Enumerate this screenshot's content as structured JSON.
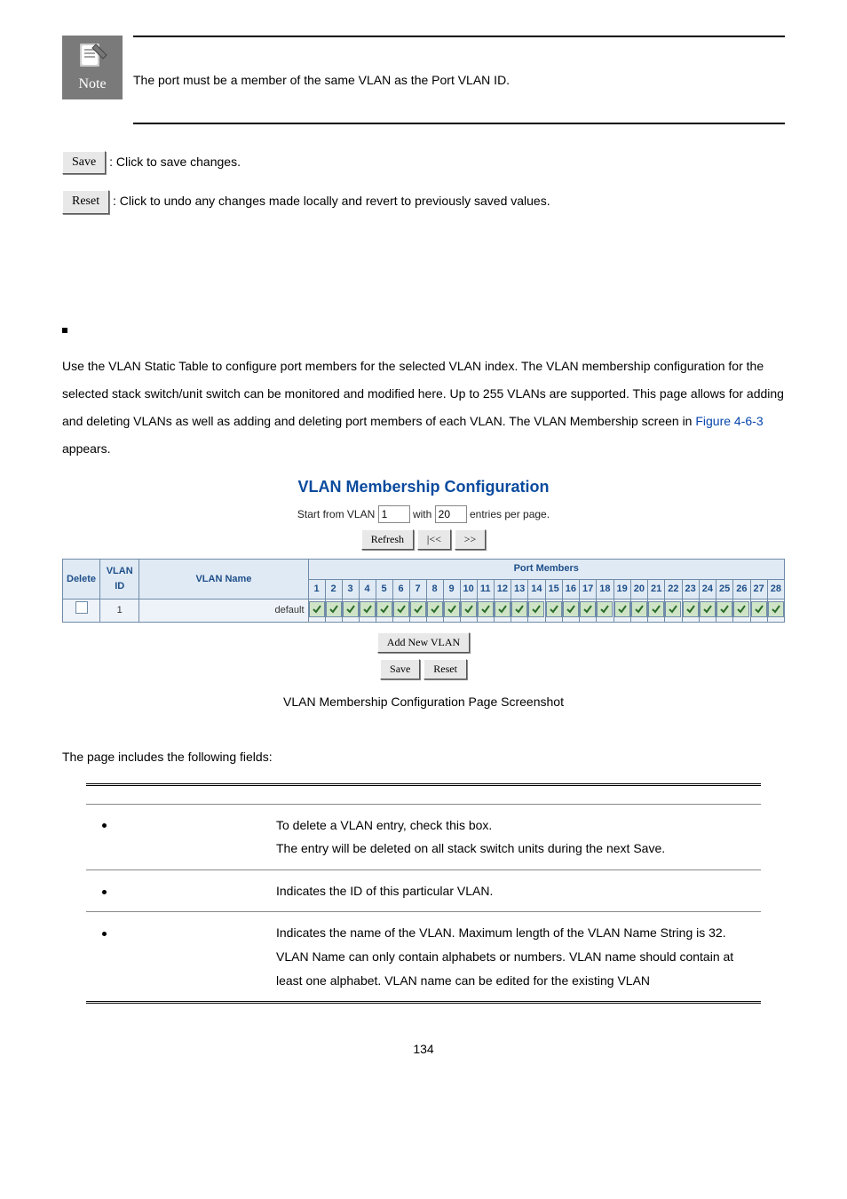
{
  "note": {
    "label": "Note",
    "text": "The port must be a member of the same VLAN as the Port VLAN ID."
  },
  "buttons": {
    "save": "Save",
    "reset": "Reset",
    "refresh": "Refresh",
    "prev": "|<<",
    "next": ">>",
    "add_new": "Add New VLAN"
  },
  "button_desc": {
    "save": ": Click to save changes.",
    "reset": ": Click to undo any changes made locally and revert to previously saved values."
  },
  "body1": "Use the VLAN Static Table to configure port members for the selected VLAN index. The VLAN membership configuration for the selected stack switch/unit switch can be monitored and modified here. Up to 255 VLANs are supported. This page allows for adding and deleting VLANs as well as adding and deleting port members of each VLAN. The VLAN Membership screen in ",
  "figure_ref": "Figure 4-6-3",
  "body1_after": " appears.",
  "vlan": {
    "title": "VLAN Membership Configuration",
    "start_label": "Start from VLAN ",
    "start_value": "1",
    "with_label": " with ",
    "per_page_value": "20",
    "entries_label": " entries per page.",
    "col": {
      "delete": "Delete",
      "vlan_id": "VLAN ID",
      "vlan_name": "VLAN Name",
      "port_members": "Port Members"
    },
    "ports": [
      "1",
      "2",
      "3",
      "4",
      "5",
      "6",
      "7",
      "8",
      "9",
      "10",
      "11",
      "12",
      "13",
      "14",
      "15",
      "16",
      "17",
      "18",
      "19",
      "20",
      "21",
      "22",
      "23",
      "24",
      "25",
      "26",
      "27",
      "28"
    ],
    "row": {
      "id": "1",
      "name": "default"
    }
  },
  "caption": "VLAN Membership Configuration Page Screenshot",
  "fields_intro": "The page includes the following fields:",
  "fields": {
    "r1": "To delete a VLAN entry, check this box.\nThe entry will be deleted on all stack switch units during the next Save.",
    "r1b": "The entry will be deleted on all stack switch units during the next Save.",
    "r2": "Indicates the ID of this particular VLAN.",
    "r3a": "Indicates the name of the VLAN. Maximum length of the VLAN Name String is 32. VLAN Name can only contain alphabets or numbers. VLAN name should contain at least one alphabet. VLAN name can be edited for the existing VLAN"
  },
  "page_number": "134"
}
